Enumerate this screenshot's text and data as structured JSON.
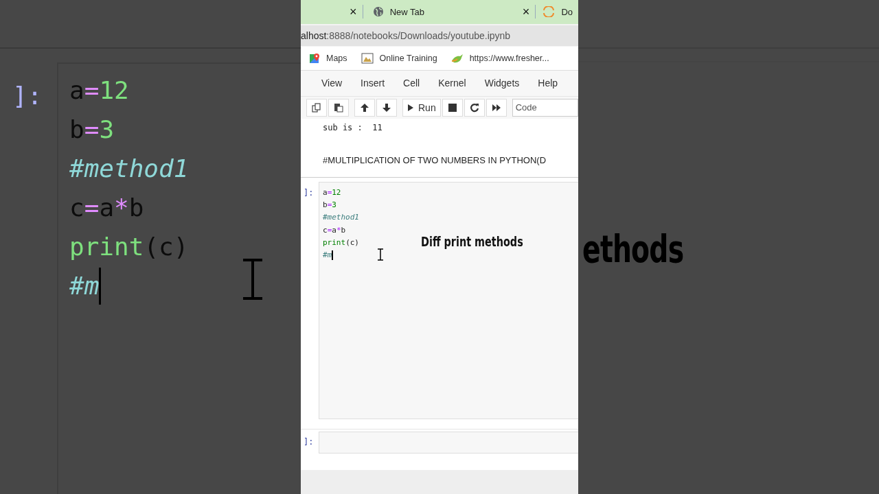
{
  "backdrop_left": {
    "prompt": "]:",
    "lines": [
      {
        "caret": false,
        "tokens": [
          {
            "text": "a",
            "kind": "var"
          },
          {
            "text": "=",
            "kind": "op"
          },
          {
            "text": "12",
            "kind": "num"
          }
        ]
      },
      {
        "caret": false,
        "tokens": [
          {
            "text": "b",
            "kind": "var"
          },
          {
            "text": "=",
            "kind": "op"
          },
          {
            "text": "3",
            "kind": "num"
          }
        ]
      },
      {
        "caret": false,
        "tokens": [
          {
            "text": "#method1",
            "kind": "comment"
          }
        ]
      },
      {
        "caret": false,
        "tokens": [
          {
            "text": "c",
            "kind": "var"
          },
          {
            "text": "=",
            "kind": "op"
          },
          {
            "text": "a",
            "kind": "var"
          },
          {
            "text": "*",
            "kind": "op"
          },
          {
            "text": "b",
            "kind": "var"
          }
        ]
      },
      {
        "caret": false,
        "tokens": [
          {
            "text": "print",
            "kind": "builtin"
          },
          {
            "text": "(c)",
            "kind": "var"
          }
        ]
      },
      {
        "caret": true,
        "tokens": [
          {
            "text": "#m",
            "kind": "comment"
          }
        ]
      }
    ]
  },
  "backdrop_right": {
    "caption": "ethods"
  },
  "tabs": [
    {
      "close": "×",
      "selected": false
    },
    {
      "label": "New Tab",
      "close": "×",
      "selected": false
    },
    {
      "label": "Do",
      "selected": false
    }
  ],
  "address": {
    "host": "alhost",
    "rest": ":8888/notebooks/Downloads/youtube.ipynb"
  },
  "bookmarks": [
    {
      "label": "Maps"
    },
    {
      "label": "Online Training"
    },
    {
      "label": "https://www.fresher..."
    }
  ],
  "menu": [
    "View",
    "Insert",
    "Cell",
    "Kernel",
    "Widgets",
    "Help"
  ],
  "toolbar": {
    "buttons": [
      {
        "kind": "copy"
      },
      {
        "kind": "paste"
      },
      {
        "kind": "up"
      },
      {
        "kind": "down"
      },
      {
        "kind": "run",
        "label": "Run"
      },
      {
        "kind": "stop"
      },
      {
        "kind": "restart"
      },
      {
        "kind": "forward"
      }
    ],
    "cell_type": "Code"
  },
  "output": "sub is :  11",
  "markdown": "#MULTIPLICATION OF TWO NUMBERS IN PYTHON(D",
  "cell": {
    "prompt": "]:",
    "lines": [
      {
        "caret": false,
        "tokens": [
          {
            "text": "a",
            "kind": "var"
          },
          {
            "text": "=",
            "kind": "op"
          },
          {
            "text": "12",
            "kind": "num"
          }
        ]
      },
      {
        "caret": false,
        "tokens": [
          {
            "text": "b",
            "kind": "var"
          },
          {
            "text": "=",
            "kind": "op"
          },
          {
            "text": "3",
            "kind": "num"
          }
        ]
      },
      {
        "caret": false,
        "tokens": [
          {
            "text": "#method1",
            "kind": "comment"
          }
        ]
      },
      {
        "caret": false,
        "tokens": [
          {
            "text": "c",
            "kind": "var"
          },
          {
            "text": "=",
            "kind": "op"
          },
          {
            "text": "a",
            "kind": "var"
          },
          {
            "text": "*",
            "kind": "op"
          },
          {
            "text": "b",
            "kind": "var"
          }
        ]
      },
      {
        "caret": false,
        "tokens": [
          {
            "text": "print",
            "kind": "builtin"
          },
          {
            "text": "(c)",
            "kind": "var"
          }
        ]
      },
      {
        "caret": true,
        "tokens": [
          {
            "text": "#m",
            "kind": "comment"
          }
        ]
      }
    ]
  },
  "caption": "Diff print methods",
  "next_cell": {
    "prompt": "]:"
  }
}
